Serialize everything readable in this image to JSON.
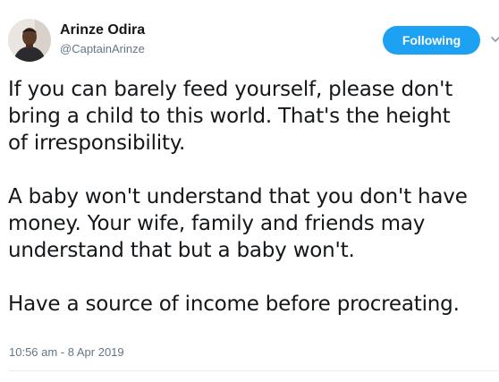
{
  "author": {
    "display_name": "Arinze Odira",
    "handle": "@CaptainArinze"
  },
  "follow_button": {
    "label": "Following"
  },
  "tweet": {
    "paragraphs": [
      {
        "lines": [
          "If you can barely feed yourself, please don't",
          "bring a child to this world. That's the height",
          "of irresponsibility."
        ]
      },
      {
        "lines": [
          "A baby won't understand that you don't have",
          "money. Your wife, family and friends may",
          "understand that but a baby won't."
        ]
      },
      {
        "lines": [
          "Have a source of income before procreating."
        ]
      }
    ],
    "timestamp": "10:56 am - 8 Apr 2019"
  },
  "colors": {
    "accent": "#1da1f2",
    "text_primary": "#14171a",
    "text_secondary": "#657786",
    "divider": "#e6ecf0"
  },
  "icons": {
    "caret": "chevron-down-icon"
  }
}
